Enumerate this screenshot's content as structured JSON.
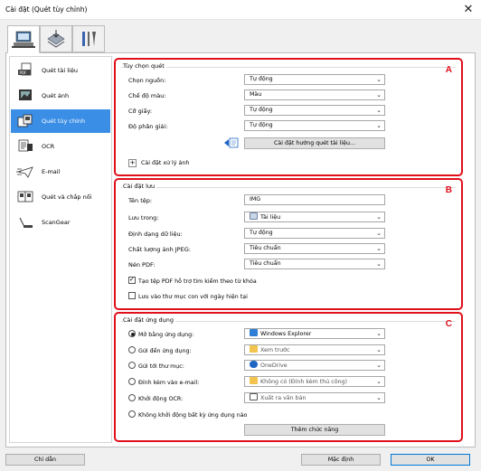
{
  "window": {
    "title": "Cài đặt (Quét tùy chỉnh)",
    "close_glyph": "✕"
  },
  "top_tabs": [
    {
      "name": "scan-tab",
      "icon": "scanner-icon"
    },
    {
      "name": "tray-tab",
      "icon": "tray-icon"
    },
    {
      "name": "tools-tab",
      "icon": "tools-icon"
    }
  ],
  "sidebar": {
    "items": [
      {
        "label": "Quét tài liệu",
        "icon": "document-scan-icon"
      },
      {
        "label": "Quét ảnh",
        "icon": "photo-scan-icon"
      },
      {
        "label": "Quét tùy chỉnh",
        "icon": "custom-scan-icon"
      },
      {
        "label": "OCR",
        "icon": "ocr-icon"
      },
      {
        "label": "E-mail",
        "icon": "email-icon"
      },
      {
        "label": "Quét và chắp nối",
        "icon": "stitch-icon"
      },
      {
        "label": "ScanGear",
        "icon": "scangear-icon"
      }
    ]
  },
  "scan_options": {
    "title": "Tùy chọn quét",
    "letter": "A",
    "rows": [
      {
        "label": "Chọn nguồn:",
        "value": "Tự động"
      },
      {
        "label": "Chế độ màu:",
        "value": "Màu"
      },
      {
        "label": "Cỡ giấy:",
        "value": "Tự động"
      },
      {
        "label": "Độ phân giải:",
        "value": "Tự động"
      }
    ],
    "guide_button": "Cài đặt hướng quét tài liệu...",
    "image_processing": "Cài đặt xử lý ảnh",
    "expand_glyph": "+"
  },
  "save_settings": {
    "title": "Cài đặt lưu",
    "letter": "B",
    "file_name_label": "Tên tệp:",
    "file_name_value": "IMG",
    "rows": [
      {
        "label": "Lưu trong:",
        "value": "Tài liệu"
      },
      {
        "label": "Định dạng dữ liệu:",
        "value": "Tự động"
      },
      {
        "label": "Chất lượng ảnh JPEG:",
        "value": "Tiêu chuẩn"
      },
      {
        "label": "Nén PDF:",
        "value": "Tiêu chuẩn"
      }
    ],
    "checkbox_pdf": "Tạo tệp PDF hỗ trợ tìm kiếm theo từ khóa",
    "checkbox_subfolder": "Lưu vào thư mục con với ngày hiện tại"
  },
  "app_settings": {
    "title": "Cài đặt ứng dụng",
    "letter": "C",
    "options": [
      {
        "label": "Mở bằng ứng dụng:",
        "value": "Windows Explorer",
        "color": "#2f7fd6"
      },
      {
        "label": "Gửi đến ứng dụng:",
        "value": "Xem trước",
        "color": "#f2c44d"
      },
      {
        "label": "Gửi tới thư mục:",
        "value": "OneDrive",
        "color": "#1f66c4"
      },
      {
        "label": "Đính kèm vào e-mail:",
        "value": "Không có (Đính kèm thủ công)",
        "color": "#f2c44d"
      },
      {
        "label": "Khởi động OCR:",
        "value": "Xuất ra văn bản",
        "color": "#555555"
      }
    ],
    "no_app": "Không khởi động bất kỳ ứng dụng nào",
    "more_button": "Thêm chức năng"
  },
  "footer": {
    "guide": "Chỉ dẫn",
    "default": "Mặc định",
    "ok": "OK"
  },
  "colors": {
    "accent": "#3b8ee6",
    "group_border": "#e0101b"
  }
}
